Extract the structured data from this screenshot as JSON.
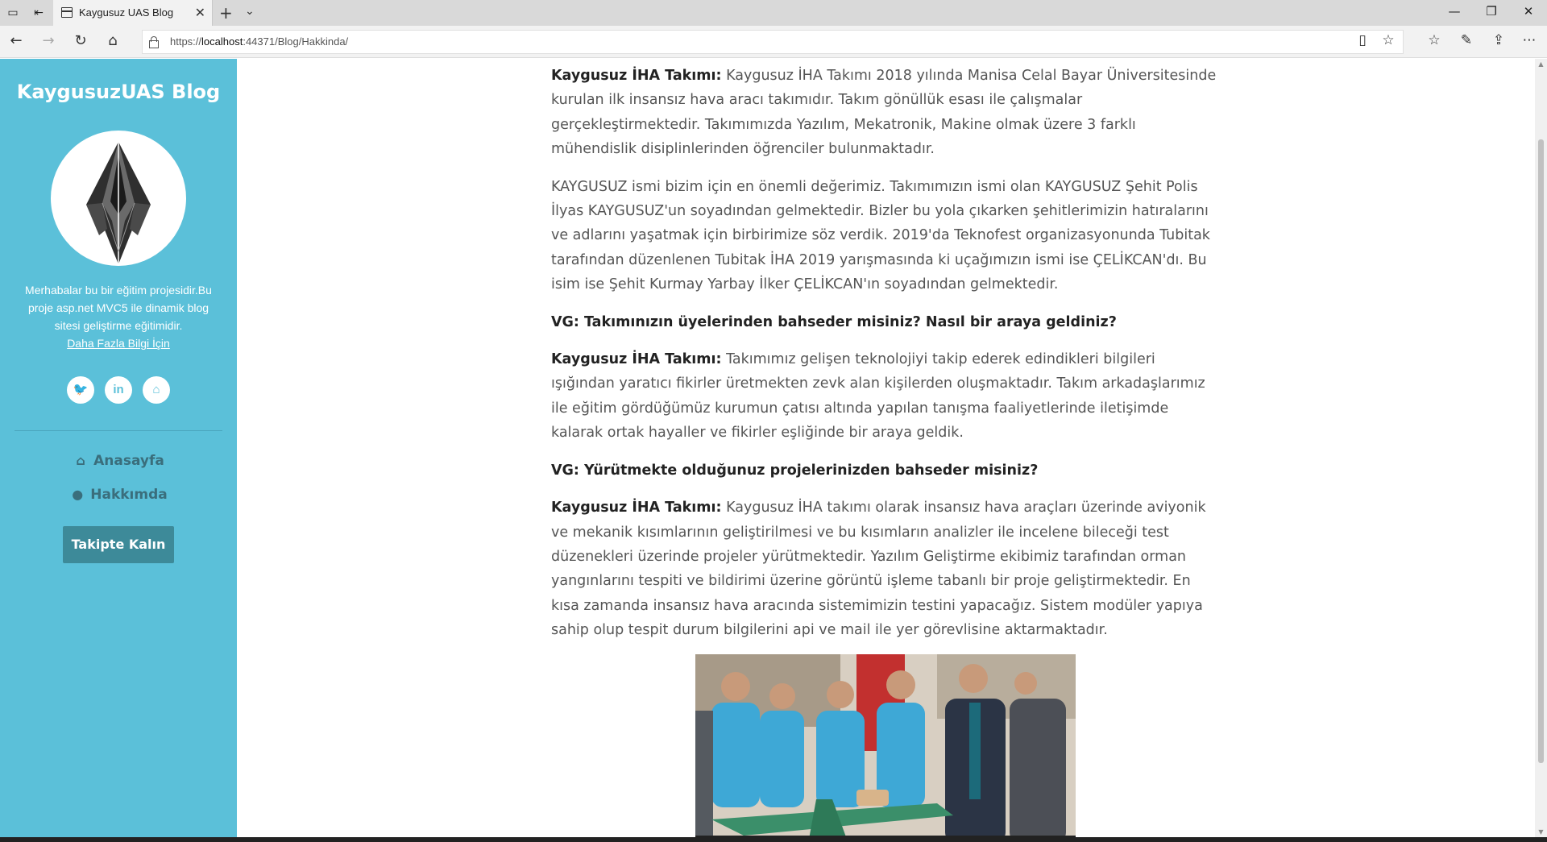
{
  "browser": {
    "tab_title": "Kaygusuz UAS Blog",
    "url_prefix": "https://",
    "url_host": "localhost",
    "url_rest": ":44371/Blog/Hakkinda/"
  },
  "sidebar": {
    "brand": "KaygusuzUAS Blog",
    "bio": "Merhabalar bu bir eğitim projesidir.Bu proje asp.net MVC5 ile dinamik blog sitesi geliştirme eğitimidir.",
    "bio_link": "Daha Fazla Bilgi İçin",
    "socials": [
      {
        "icon": "twitter-icon",
        "glyph": "🐦"
      },
      {
        "icon": "linkedin-icon",
        "glyph": "in"
      },
      {
        "icon": "github-icon",
        "glyph": "⌂"
      }
    ],
    "nav": [
      {
        "icon": "home-icon",
        "label": "Anasayfa"
      },
      {
        "icon": "user-icon",
        "label": "Hakkımda"
      }
    ],
    "follow_button": "Takipte Kalın"
  },
  "content": {
    "p1_lead": "Kaygusuz İHA Takımı:",
    "p1_text": " Kaygusuz İHA Takımı 2018 yılında Manisa Celal Bayar Üniversitesinde kurulan ilk insansız hava aracı takımıdır. Takım gönüllük esası ile çalışmalar gerçekleştirmektedir. Takımımızda Yazılım, Mekatronik, Makine olmak üzere 3 farklı mühendislik disiplinlerinden öğrenciler bulunmaktadır.",
    "p2_text": "KAYGUSUZ ismi bizim için en önemli değerimiz. Takımımızın ismi olan KAYGUSUZ Şehit Polis İlyas KAYGUSUZ'un soyadından gelmektedir. Bizler bu yola çıkarken şehitlerimizin hatıralarını ve adlarını yaşatmak için birbirimize söz verdik. 2019'da Teknofest organizasyonunda Tubitak tarafından düzenlenen Tubitak İHA 2019 yarışmasında ki uçağımızın ismi ise ÇELİKCAN'dı. Bu isim ise Şehit Kurmay Yarbay İlker ÇELİKCAN'ın soyadından gelmektedir.",
    "q1": "VG: Takımınızın üyelerinden bahseder misiniz? Nasıl bir araya geldiniz?",
    "a1_lead": "Kaygusuz İHA Takımı:",
    "a1_text": " Takımımız gelişen teknolojiyi takip ederek edindikleri bilgileri ışığından yaratıcı fikirler üretmekten zevk alan kişilerden oluşmaktadır. Takım arkadaşlarımız ile eğitim gördüğümüz kurumun çatısı altında yapılan tanışma faaliyetlerinde iletişimde kalarak ortak hayaller ve fikirler eşliğinde bir araya geldik.",
    "q2": "VG: Yürütmekte olduğunuz projelerinizden bahseder misiniz?",
    "a2_lead": "Kaygusuz İHA Takımı:",
    "a2_text": " Kaygusuz İHA takımı olarak insansız hava araçları üzerinde aviyonik ve mekanik kısımlarının geliştirilmesi ve bu kısımların analizler ile incelene bileceği test düzenekleri üzerinde projeler yürütmektedir. Yazılım Geliştirme ekibimiz tarafından orman yangınlarını tespiti ve bildirimi üzerine görüntü işleme tabanlı bir proje geliştirmektedir. En kısa zamanda insansız hava aracında sistemimizin testini yapacağız. Sistem modüler yapıya sahip olup tespit durum bilgilerini api ve mail ile yer görevlisine aktarmaktadır."
  },
  "colors": {
    "sidebar_bg": "#5bc0d9",
    "nav_text": "#3a6e7c",
    "button_bg": "#3d8a99"
  }
}
